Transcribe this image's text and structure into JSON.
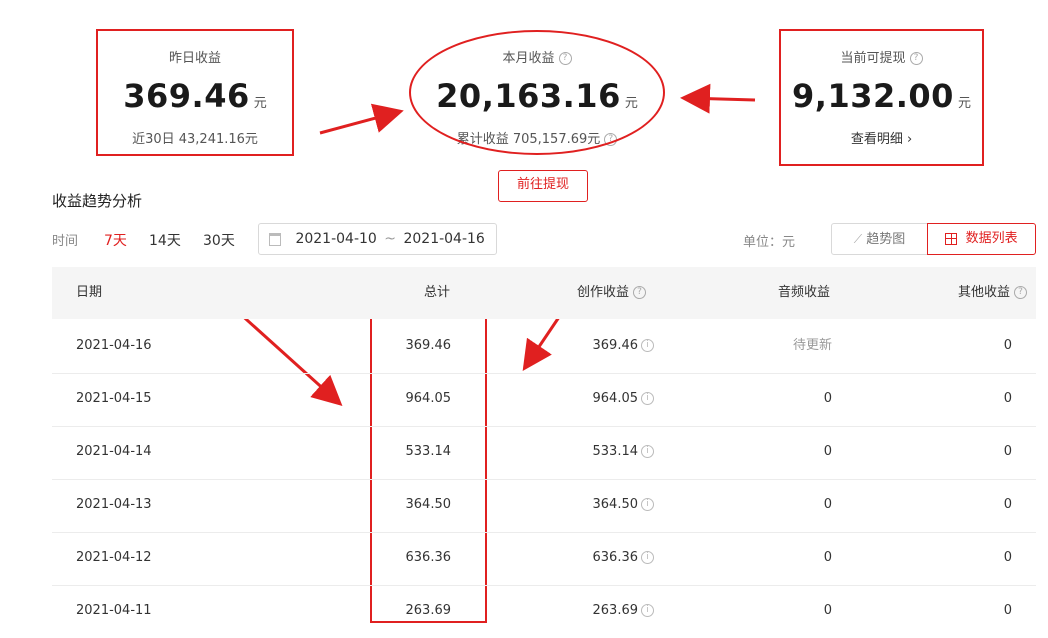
{
  "stats": {
    "yesterday": {
      "label": "昨日收益",
      "value": "369.46",
      "unit": "元",
      "sub_label": "近30日",
      "sub_value": "43,241.16",
      "sub_unit": "元"
    },
    "month": {
      "label": "本月收益",
      "value": "20,163.16",
      "unit": "元",
      "sub_label": "累计收益",
      "sub_value": "705,157.69",
      "sub_unit": "元"
    },
    "withdraw": {
      "label": "当前可提现",
      "value": "9,132.00",
      "unit": "元",
      "link": "查看明细 ›"
    }
  },
  "withdraw_button": "前往提现",
  "section_title": "收益趋势分析",
  "filters": {
    "label": "时间",
    "options": [
      "7天",
      "14天",
      "30天"
    ],
    "date_start": "2021-04-10",
    "date_sep": "~",
    "date_end": "2021-04-16"
  },
  "unit_label": "单位：元",
  "view_toggle": {
    "trend": "趋势图",
    "list": "数据列表"
  },
  "table": {
    "headers": {
      "date": "日期",
      "total": "总计",
      "creation": "创作收益",
      "audio": "音频收益",
      "other": "其他收益"
    },
    "rows": [
      {
        "date": "2021-04-16",
        "total": "369.46",
        "creation": "369.46",
        "audio": "待更新",
        "other": "0"
      },
      {
        "date": "2021-04-15",
        "total": "964.05",
        "creation": "964.05",
        "audio": "0",
        "other": "0"
      },
      {
        "date": "2021-04-14",
        "total": "533.14",
        "creation": "533.14",
        "audio": "0",
        "other": "0"
      },
      {
        "date": "2021-04-13",
        "total": "364.50",
        "creation": "364.50",
        "audio": "0",
        "other": "0"
      },
      {
        "date": "2021-04-12",
        "total": "636.36",
        "creation": "636.36",
        "audio": "0",
        "other": "0"
      },
      {
        "date": "2021-04-11",
        "total": "263.69",
        "creation": "263.69",
        "audio": "0",
        "other": "0"
      }
    ]
  },
  "colors": {
    "accent": "#e02020",
    "header_bg": "#f5f5f5"
  }
}
